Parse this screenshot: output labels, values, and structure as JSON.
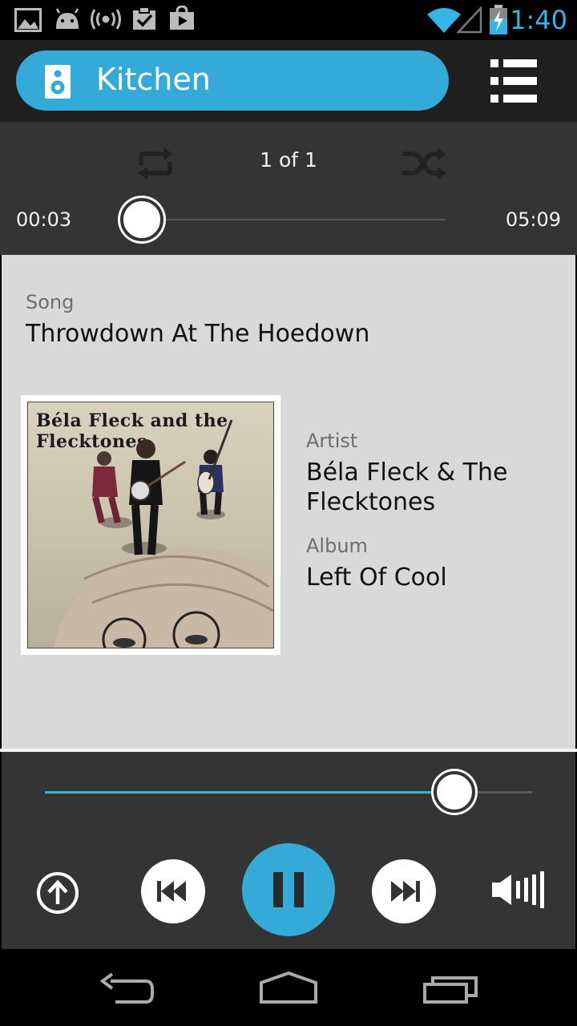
{
  "status_bar": {
    "time": "1:40",
    "icons": [
      "picture-icon",
      "android-icon",
      "broadcast-icon",
      "clipboard-check-icon",
      "play-store-icon",
      "wifi-icon",
      "signal-icon",
      "battery-charging-icon"
    ]
  },
  "header": {
    "room_name": "Kitchen",
    "room_icon": "speaker-icon",
    "queue_icon": "queue-list-icon"
  },
  "playback": {
    "track_count": "1 of 1",
    "elapsed": "00:03",
    "total": "05:09",
    "progress_fraction": 0.01
  },
  "now_playing": {
    "song_label": "Song",
    "song": "Throwdown At The Hoedown",
    "artist_label": "Artist",
    "artist": "Béla Fleck & The Flecktones",
    "album_label": "Album",
    "album": "Left Of Cool",
    "album_art_text": "Béla Fleck and the Flecktones"
  },
  "controls": {
    "volume_fraction": 0.84,
    "accent_color": "#33b5e5"
  }
}
